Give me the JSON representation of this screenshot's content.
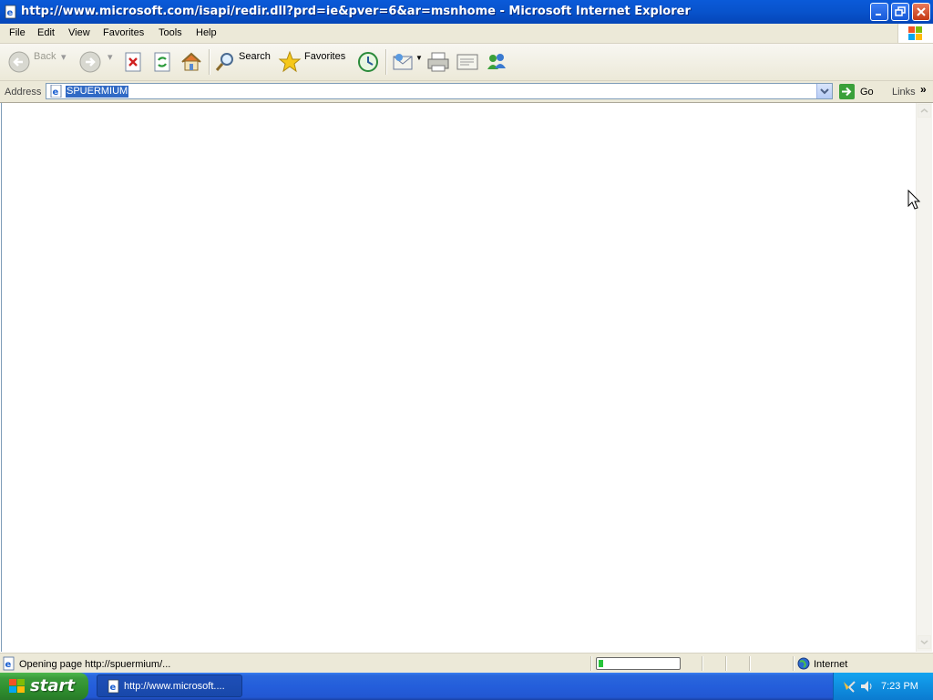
{
  "window": {
    "title": "http://www.microsoft.com/isapi/redir.dll?prd=ie&pver=6&ar=msnhome - Microsoft Internet Explorer"
  },
  "menu": {
    "items": [
      "File",
      "Edit",
      "View",
      "Favorites",
      "Tools",
      "Help"
    ]
  },
  "toolbar": {
    "back_label": "Back",
    "search_label": "Search",
    "favorites_label": "Favorites"
  },
  "address_bar": {
    "label": "Address",
    "value": "SPUERMIUM",
    "go_label": "Go",
    "links_label": "Links"
  },
  "status_bar": {
    "text": "Opening page http://spuermium/...",
    "progress_fraction": 0.06,
    "zone": "Internet"
  },
  "taskbar": {
    "start_label": "start",
    "window_button_label": "http://www.microsoft....",
    "clock": "7:23 PM"
  },
  "colors": {
    "titlebar_blue": "#0853cc",
    "start_green": "#3c9c3c",
    "selection_blue": "#316ac5",
    "progress_green": "#26c43a"
  }
}
